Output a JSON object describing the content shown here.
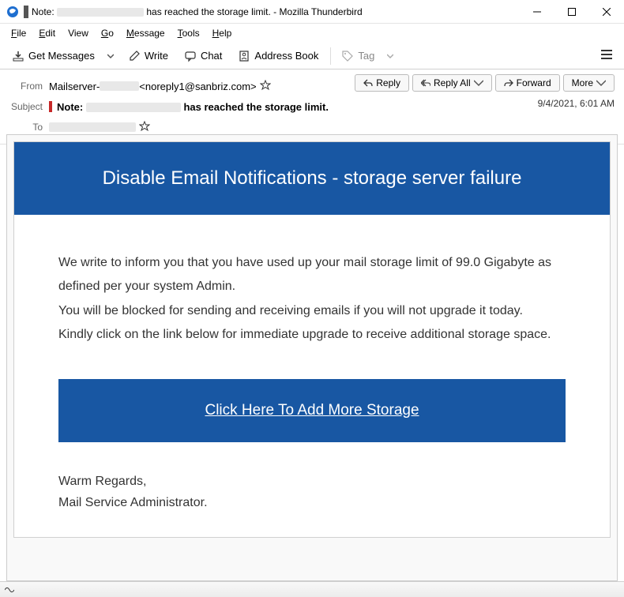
{
  "window": {
    "title_prefix": "Note:",
    "title_suffix": " has reached the storage limit. - Mozilla Thunderbird"
  },
  "menu": {
    "file": "File",
    "edit": "Edit",
    "view": "View",
    "go": "Go",
    "message": "Message",
    "tools": "Tools",
    "help": "Help"
  },
  "toolbar": {
    "get_messages": "Get Messages",
    "write": "Write",
    "chat": "Chat",
    "address_book": "Address Book",
    "tag": "Tag"
  },
  "header": {
    "from_label": "From",
    "subject_label": "Subject",
    "to_label": "To",
    "from_prefix": "Mailserver-",
    "from_email": " <noreply1@sanbriz.com>",
    "subject_prefix": "Note:",
    "subject_suffix": " has reached the storage limit.",
    "date": "9/4/2021, 6:01 AM",
    "reply": "Reply",
    "reply_all": "Reply All",
    "forward": "Forward",
    "more": "More"
  },
  "email": {
    "banner": "Disable Email Notifications - storage server failure",
    "para1": "We write to inform you that you have used up your mail storage limit of 99.0 Gigabyte as defined per your system Admin.",
    "para2": "You will be blocked for sending and receiving emails if you will not upgrade it today.",
    "para3": "Kindly click on the link below for immediate upgrade to receive additional storage space.",
    "cta": "Click Here To Add More Storage",
    "sig1": "Warm Regards,",
    "sig2": "Mail Service Administrator."
  }
}
